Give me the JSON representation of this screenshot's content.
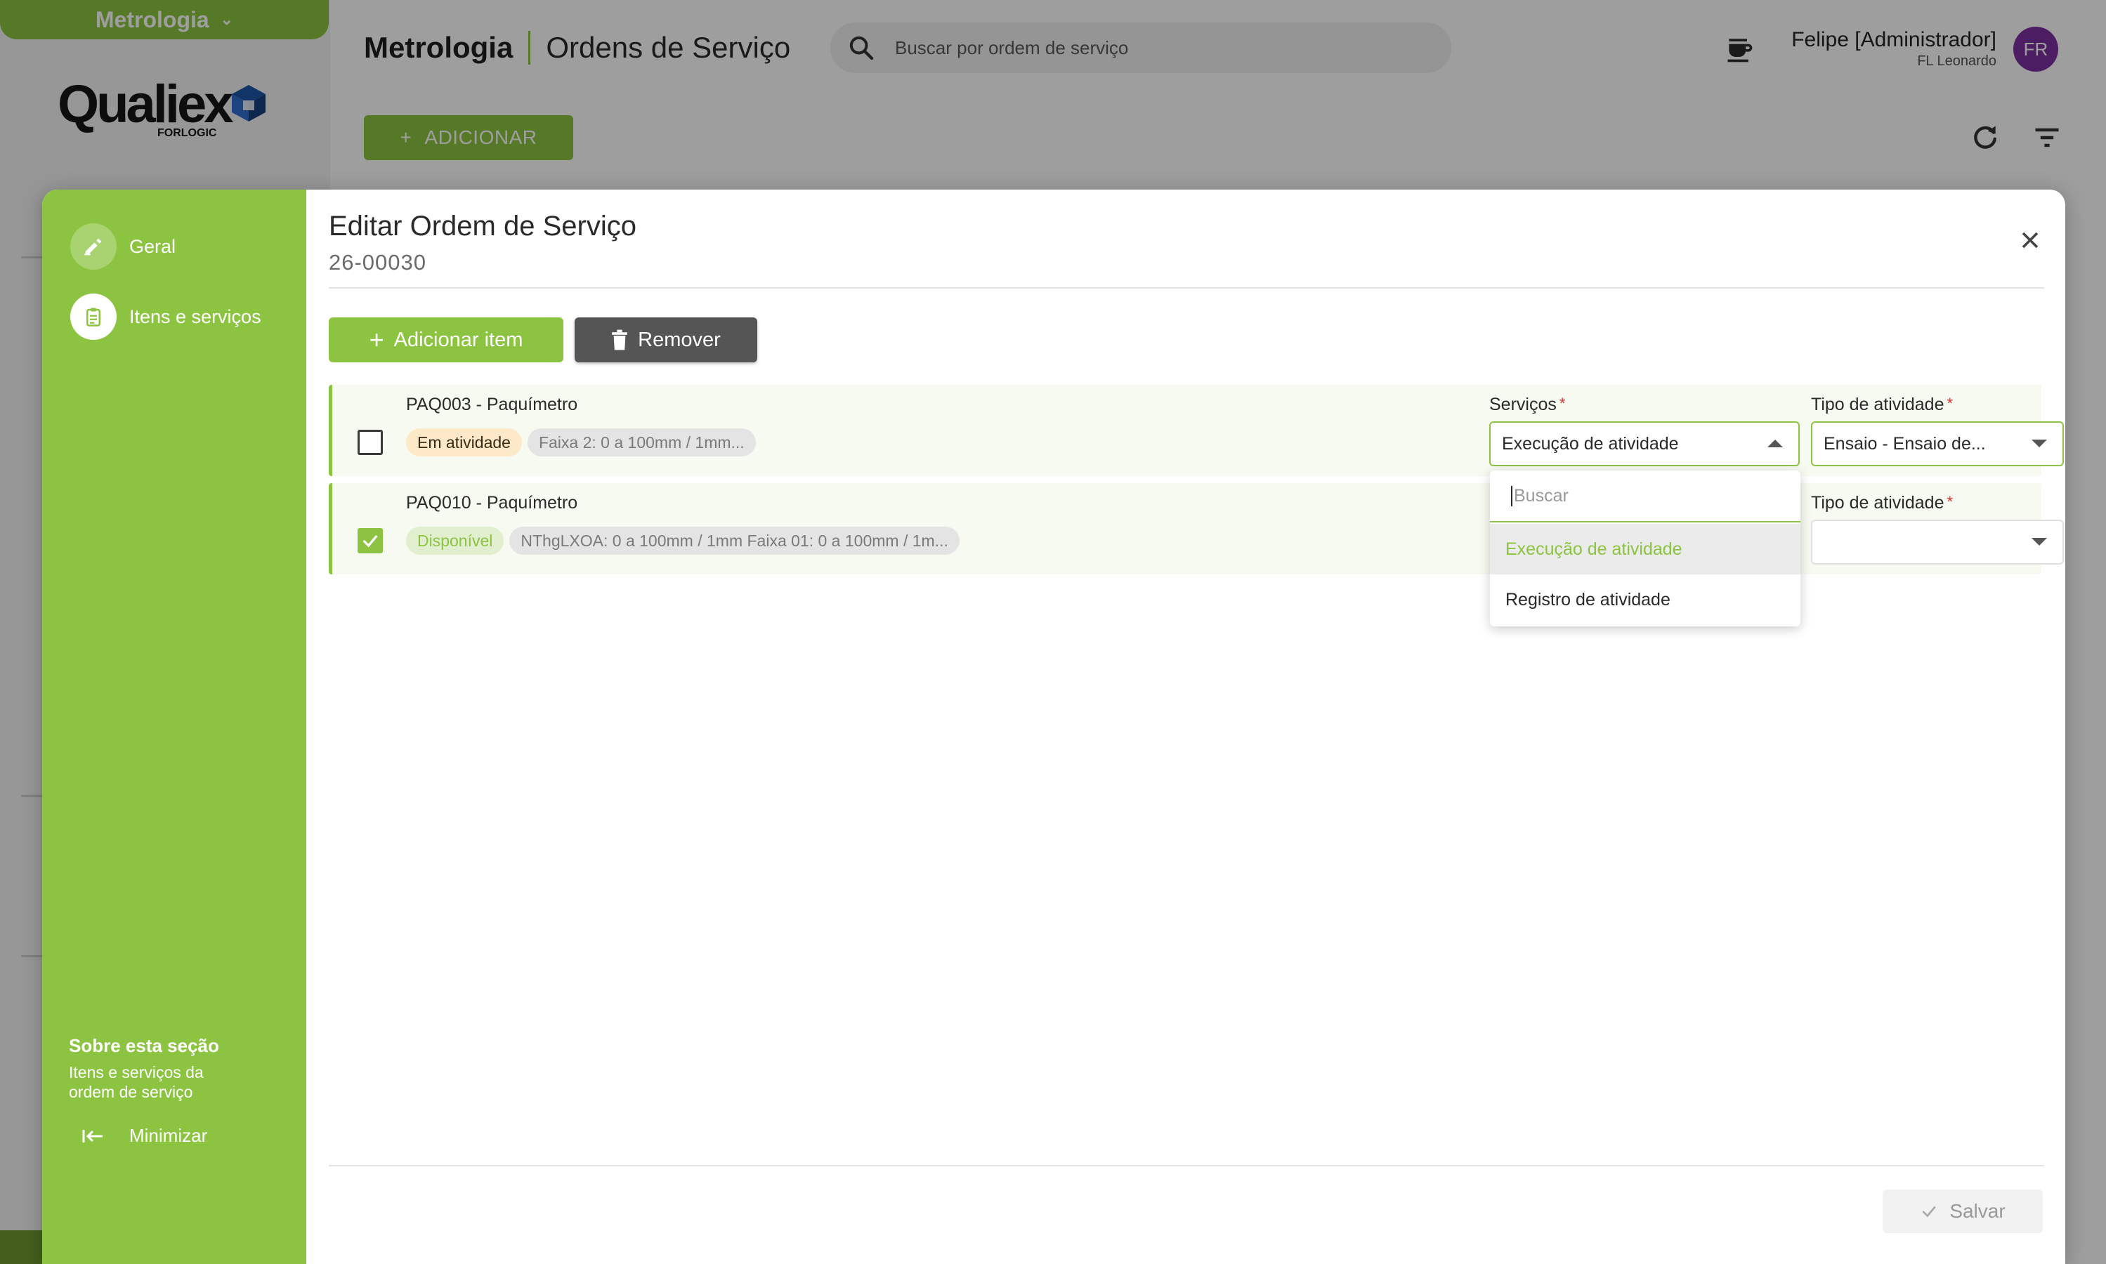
{
  "app": {
    "module_label": "Metrologia",
    "logo_text": "Qualiex",
    "logo_sub": "FORLOGIC",
    "header": {
      "module": "Metrologia",
      "page": "Ordens de Serviço",
      "search_placeholder": "Buscar por ordem de serviço"
    },
    "user": {
      "name": "Felipe [Administrador]",
      "org": "FL Leonardo",
      "initials": "FR",
      "avatar_color": "#7b2fa0"
    },
    "add_label": "ADICIONAR",
    "accent_color": "#8cc442"
  },
  "modal": {
    "title": "Editar Ordem de Serviço",
    "subtitle": "26-00030",
    "sidebar": {
      "items": [
        {
          "label": "Geral",
          "icon": "pen-icon",
          "active": false
        },
        {
          "label": "Itens e serviços",
          "icon": "clipboard-icon",
          "active": true
        }
      ],
      "about_title": "Sobre esta seção",
      "about_text": "Itens e serviços da ordem de serviço",
      "minimize_label": "Minimizar"
    },
    "toolbar": {
      "add_item_label": "Adicionar item",
      "remove_label": "Remover"
    },
    "items": [
      {
        "code": "PAQ003 - Paquímetro",
        "checked": false,
        "status": "Em atividade",
        "range": "Faixa 2: 0 a 100mm / 1mm...",
        "services_label": "Serviços",
        "services_value": "Execução de atividade",
        "activity_label": "Tipo de atividade",
        "activity_value": "Ensaio - Ensaio de..."
      },
      {
        "code": "PAQ010 - Paquímetro",
        "checked": true,
        "status": "Disponível",
        "range": "NThgLXOA: 0 a 100mm / 1mm Faixa 01: 0 a 100mm / 1m...",
        "activity_label": "Tipo de atividade",
        "activity_value": ""
      }
    ],
    "dropdown": {
      "search_placeholder": "Buscar",
      "options": [
        {
          "label": "Execução de atividade",
          "selected": true
        },
        {
          "label": "Registro de atividade",
          "selected": false
        }
      ]
    },
    "save_label": "Salvar"
  }
}
